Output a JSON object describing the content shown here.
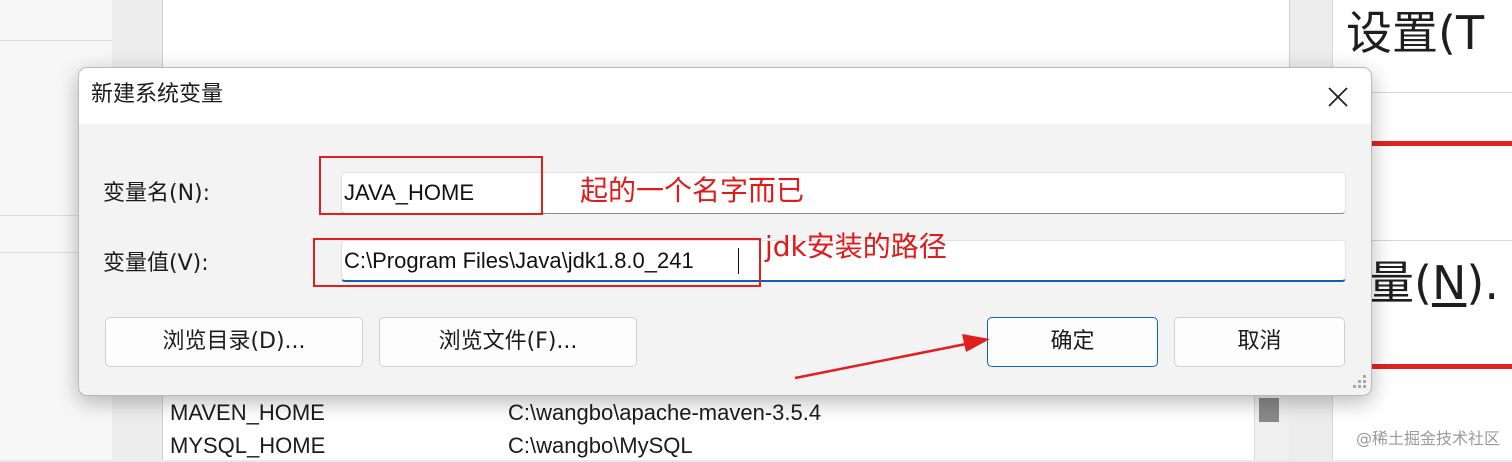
{
  "background": {
    "env_rows": [
      {
        "name": "MAVEN_HOME",
        "value": "C:\\wangbo\\apache-maven-3.5.4"
      },
      {
        "name": "MYSQL_HOME",
        "value": "C:\\wangbo\\MySQL"
      }
    ],
    "right_title": "设置(T",
    "right_var_prefix": "量(",
    "right_var_key": "N",
    "right_var_suffix": ")."
  },
  "dialog": {
    "title": "新建系统变量",
    "name_label": "变量名(N):",
    "name_value": "JAVA_HOME",
    "value_label": "变量值(V):",
    "value_value": "C:\\Program Files\\Java\\jdk1.8.0_241",
    "browse_dir_label": "浏览目录(D)...",
    "browse_file_label": "浏览文件(F)...",
    "ok_label": "确定",
    "cancel_label": "取消"
  },
  "annotations": {
    "name_note": "起的一个名字而已",
    "value_note": "jdk安装的路径",
    "color": "#e01b1b"
  },
  "watermark": "@稀土掘金技术社区",
  "colors": {
    "accent": "#0a64c8",
    "annotation_red": "#e02020"
  },
  "icons": {
    "close": "close-icon",
    "resize_grip": "resize-grip-icon",
    "arrow": "annotation-arrow"
  }
}
